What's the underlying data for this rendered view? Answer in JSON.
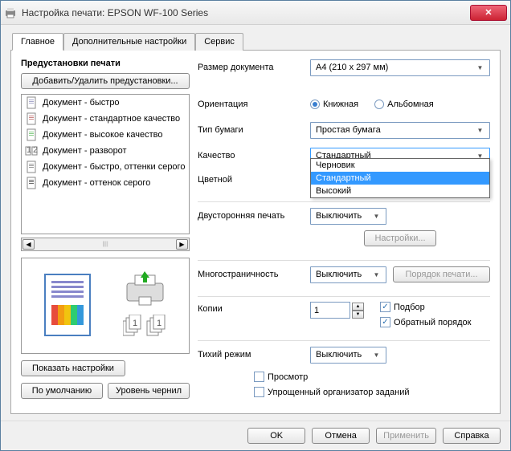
{
  "window": {
    "title": "Настройка печати: EPSON WF-100 Series"
  },
  "tabs": [
    {
      "label": "Главное"
    },
    {
      "label": "Дополнительные настройки"
    },
    {
      "label": "Сервис"
    }
  ],
  "presets": {
    "title": "Предустановки печати",
    "add_remove": "Добавить/Удалить предустановки...",
    "items": [
      {
        "label": "Документ - быстро"
      },
      {
        "label": "Документ - стандартное качество"
      },
      {
        "label": "Документ - высокое качество"
      },
      {
        "label": "Документ - разворот"
      },
      {
        "label": "Документ - быстро, оттенки серого"
      },
      {
        "label": "Документ - оттенок серого"
      }
    ]
  },
  "left_buttons": {
    "show_settings": "Показать настройки",
    "defaults": "По умолчанию",
    "ink_levels": "Уровень чернил"
  },
  "form": {
    "doc_size": {
      "label": "Размер документа",
      "value": "A4 (210 x 297 мм)"
    },
    "orientation": {
      "label": "Ориентация",
      "portrait": "Книжная",
      "landscape": "Альбомная"
    },
    "paper_type": {
      "label": "Тип бумаги",
      "value": "Простая бумага"
    },
    "quality": {
      "label": "Качество",
      "value": "Стандартный",
      "options": [
        "Черновик",
        "Стандартный",
        "Высокий"
      ]
    },
    "color": {
      "label": "Цветной"
    },
    "duplex": {
      "label": "Двусторонняя печать",
      "value": "Выключить",
      "settings_btn": "Настройки..."
    },
    "multipage": {
      "label": "Многостраничность",
      "value": "Выключить",
      "order_btn": "Порядок печати..."
    },
    "copies": {
      "label": "Копии",
      "value": "1",
      "collate": "Подбор",
      "reverse": "Обратный порядок"
    },
    "quiet": {
      "label": "Тихий режим",
      "value": "Выключить"
    },
    "preview": "Просмотр",
    "organizer": "Упрощенный организатор заданий"
  },
  "footer": {
    "ok": "OK",
    "cancel": "Отмена",
    "apply": "Применить",
    "help": "Справка"
  }
}
